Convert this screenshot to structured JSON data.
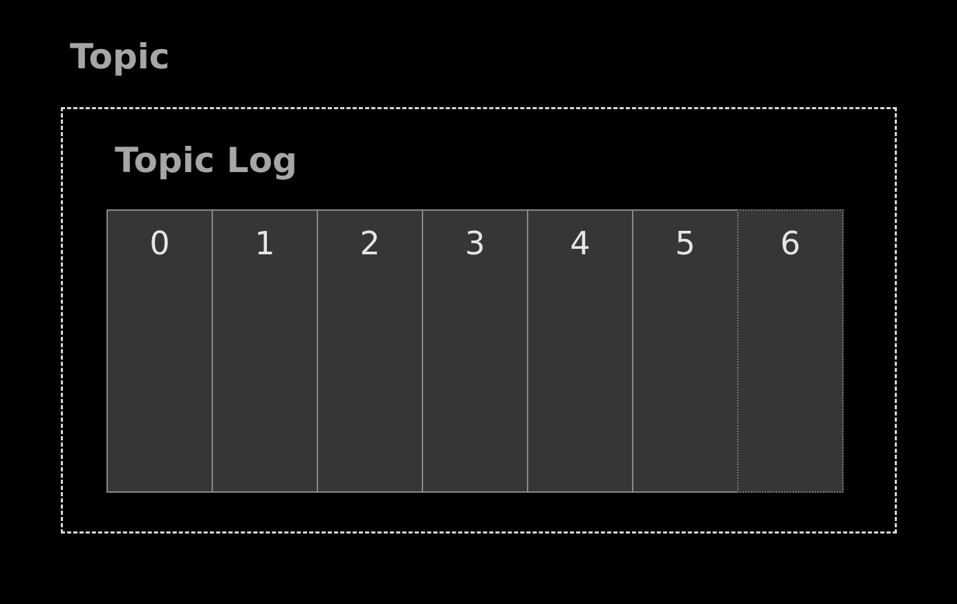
{
  "topic": {
    "title": "Topic"
  },
  "log": {
    "title": "Topic Log",
    "segments": [
      {
        "label": "0",
        "state": "written"
      },
      {
        "label": "1",
        "state": "written"
      },
      {
        "label": "2",
        "state": "written"
      },
      {
        "label": "3",
        "state": "written"
      },
      {
        "label": "4",
        "state": "written"
      },
      {
        "label": "5",
        "state": "written"
      },
      {
        "label": "6",
        "state": "pending"
      }
    ]
  },
  "colors": {
    "background": "#000000",
    "title_text": "#a6a6a6",
    "segment_fill": "#363636",
    "segment_border": "#8a8a8a",
    "segment_text": "#e6e6e6",
    "container_border": "#d9d9d9"
  }
}
